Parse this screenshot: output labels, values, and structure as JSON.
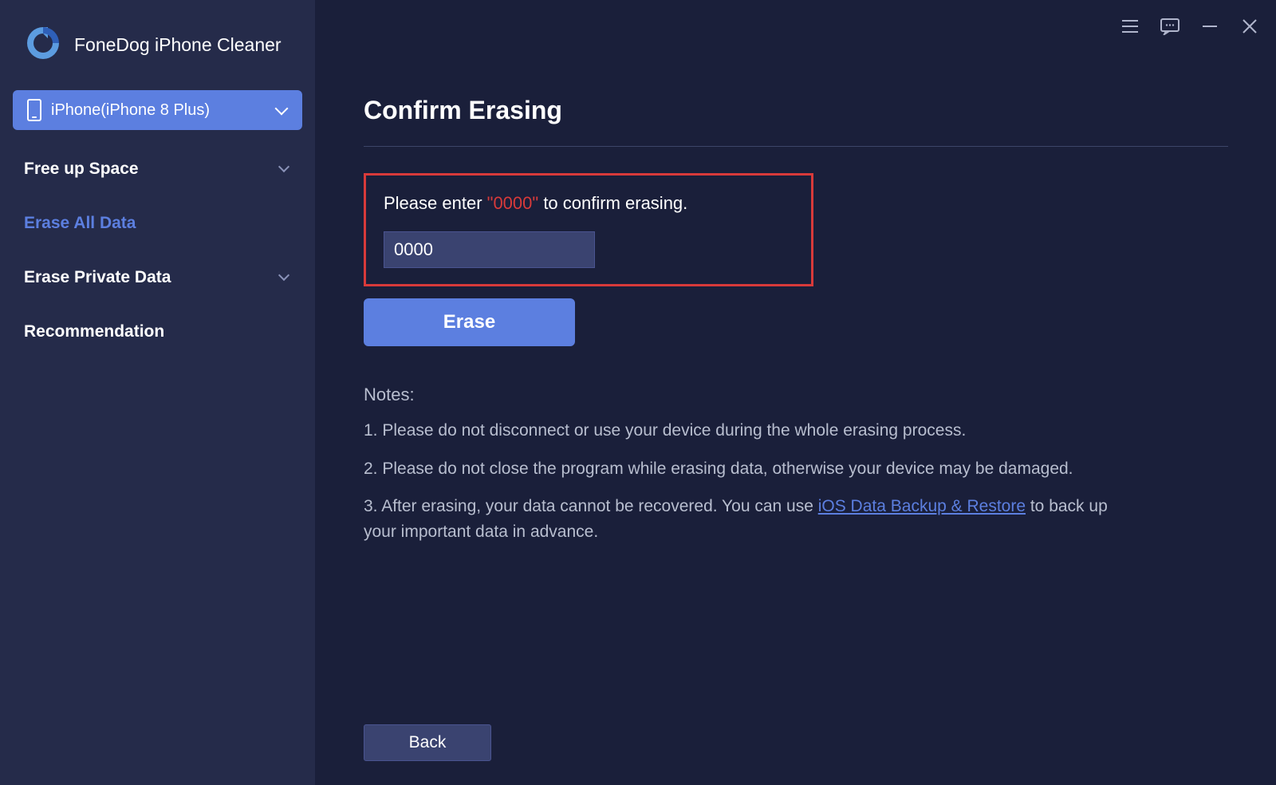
{
  "app": {
    "title": "FoneDog iPhone Cleaner"
  },
  "device": {
    "name": "iPhone(iPhone 8 Plus)"
  },
  "sidebar": {
    "items": [
      {
        "label": "Free up Space",
        "has_chevron": true,
        "active": false
      },
      {
        "label": "Erase All Data",
        "has_chevron": false,
        "active": true
      },
      {
        "label": "Erase Private Data",
        "has_chevron": true,
        "active": false
      },
      {
        "label": "Recommendation",
        "has_chevron": false,
        "active": false
      }
    ]
  },
  "main": {
    "title": "Confirm Erasing",
    "prompt_pre": "Please enter ",
    "prompt_code": "\"0000\"",
    "prompt_post": " to confirm erasing.",
    "input_value": "0000",
    "erase_label": "Erase",
    "back_label": "Back"
  },
  "notes": {
    "heading": "Notes:",
    "n1": "1. Please do not disconnect or use your device during the whole erasing process.",
    "n2": "2. Please do not close the program while erasing data, otherwise your device may be damaged.",
    "n3_pre": "3. After erasing, your data cannot be recovered. You can use ",
    "n3_link": "iOS Data Backup & Restore",
    "n3_post": " to back up your important data in advance."
  }
}
